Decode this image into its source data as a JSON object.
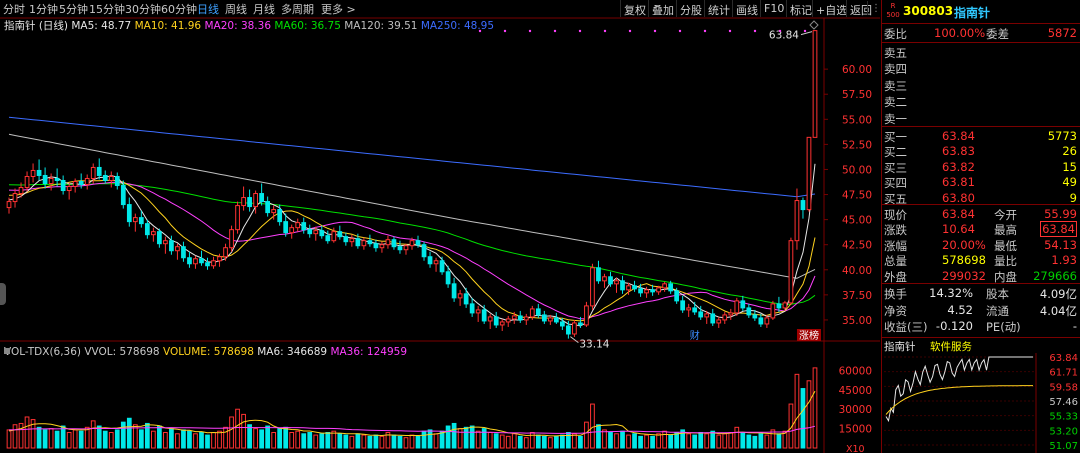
{
  "toolbar": {
    "periods": [
      "分时",
      "1分钟",
      "5分钟",
      "15分钟",
      "30分钟",
      "60分钟",
      "日线",
      "周线",
      "月线",
      "多周期",
      "更多 >"
    ],
    "active_period": "日线",
    "actions": [
      "复权",
      "叠加",
      "分股",
      "统计",
      "画线",
      "F10",
      "标记",
      "+自选",
      "返回"
    ]
  },
  "ma_legend": {
    "name": "指南针 (日线)",
    "items": [
      {
        "label": "MA5: 48.77",
        "color": "#e6e6e6"
      },
      {
        "label": "MA10: 41.96",
        "color": "#ffd21e"
      },
      {
        "label": "MA20: 38.36",
        "color": "#ff40ff"
      },
      {
        "label": "MA60: 36.75",
        "color": "#00e000"
      },
      {
        "label": "MA120: 39.51",
        "color": "#bfbfbf"
      },
      {
        "label": "MA250: 48.95",
        "color": "#3c6cff"
      }
    ]
  },
  "vol_legend": {
    "items": [
      {
        "label": "VOL-TDX(6,36)",
        "color": "#c8c8c8"
      },
      {
        "label": "VVOL: 578698",
        "color": "#c8c8c8"
      },
      {
        "label": "VOLUME: 578698",
        "color": "#ffd21e"
      },
      {
        "label": "MA6: 346689",
        "color": "#e6e6e6"
      },
      {
        "label": "MA36: 124959",
        "color": "#ff40ff"
      }
    ]
  },
  "chart_data": {
    "type": "candlestick",
    "price_axis": {
      "ticks": [
        "60.00",
        "57.50",
        "55.00",
        "52.50",
        "50.00",
        "47.50",
        "45.00",
        "42.50",
        "40.00",
        "37.50",
        "35.00"
      ],
      "range": [
        33.0,
        64.5
      ]
    },
    "volume_axis": {
      "ticks": [
        "60000",
        "45000",
        "30000",
        "15000"
      ],
      "unit": "X10"
    },
    "annotations": {
      "high": "63.84",
      "low": "33.14",
      "finance_badge": "财",
      "limit_badge": "涨榜"
    },
    "ohlc": [
      [
        46.2,
        47.2,
        45.6,
        46.8
      ],
      [
        46.8,
        48.1,
        46.2,
        47.6
      ],
      [
        47.6,
        48.7,
        47.2,
        48.2
      ],
      [
        48.2,
        49.8,
        47.8,
        49.3
      ],
      [
        49.3,
        50.6,
        48.7,
        49.9
      ],
      [
        49.9,
        51.0,
        48.9,
        49.4
      ],
      [
        49.4,
        50.2,
        48.1,
        48.6
      ],
      [
        48.6,
        49.6,
        47.9,
        49.1
      ],
      [
        49.1,
        50.1,
        48.3,
        48.9
      ],
      [
        48.9,
        49.4,
        47.5,
        47.9
      ],
      [
        47.9,
        48.6,
        47.0,
        48.3
      ],
      [
        48.3,
        49.1,
        47.7,
        48.8
      ],
      [
        48.8,
        49.6,
        48.1,
        48.5
      ],
      [
        48.5,
        49.5,
        48.0,
        49.1
      ],
      [
        49.1,
        50.6,
        48.6,
        50.2
      ],
      [
        50.2,
        51.1,
        49.0,
        49.4
      ],
      [
        49.4,
        49.9,
        48.6,
        48.9
      ],
      [
        48.9,
        49.8,
        48.2,
        49.3
      ],
      [
        49.3,
        49.7,
        48.0,
        48.4
      ],
      [
        48.4,
        48.9,
        46.1,
        46.5
      ],
      [
        46.5,
        47.2,
        44.3,
        44.8
      ],
      [
        44.8,
        45.6,
        43.8,
        45.2
      ],
      [
        45.2,
        45.9,
        44.2,
        44.6
      ],
      [
        44.6,
        45.0,
        43.1,
        43.5
      ],
      [
        43.5,
        44.2,
        42.8,
        43.8
      ],
      [
        43.8,
        44.1,
        42.2,
        42.6
      ],
      [
        42.6,
        43.3,
        41.6,
        42.9
      ],
      [
        42.9,
        43.4,
        41.5,
        41.9
      ],
      [
        41.9,
        42.6,
        41.0,
        42.3
      ],
      [
        42.3,
        42.8,
        40.8,
        41.2
      ],
      [
        41.2,
        41.8,
        40.2,
        40.6
      ],
      [
        40.6,
        41.4,
        40.1,
        41.1
      ],
      [
        41.1,
        41.9,
        40.4,
        40.7
      ],
      [
        40.7,
        41.2,
        40.0,
        40.4
      ],
      [
        40.4,
        41.3,
        40.1,
        40.9
      ],
      [
        40.9,
        41.6,
        40.3,
        41.3
      ],
      [
        41.3,
        42.6,
        40.9,
        42.2
      ],
      [
        42.2,
        44.4,
        41.8,
        44.0
      ],
      [
        44.0,
        46.8,
        43.6,
        46.4
      ],
      [
        46.4,
        48.3,
        45.9,
        47.2
      ],
      [
        47.2,
        48.0,
        45.8,
        46.3
      ],
      [
        46.3,
        47.9,
        45.6,
        47.6
      ],
      [
        47.6,
        48.6,
        46.4,
        46.8
      ],
      [
        46.8,
        47.3,
        45.3,
        45.7
      ],
      [
        45.7,
        46.4,
        45.0,
        46.0
      ],
      [
        46.0,
        46.5,
        44.4,
        44.8
      ],
      [
        44.8,
        45.6,
        43.3,
        43.7
      ],
      [
        43.7,
        44.5,
        43.1,
        44.2
      ],
      [
        44.2,
        45.1,
        43.8,
        44.7
      ],
      [
        44.7,
        45.2,
        43.6,
        44.0
      ],
      [
        44.0,
        44.5,
        43.2,
        43.6
      ],
      [
        43.6,
        44.3,
        42.9,
        43.9
      ],
      [
        43.9,
        44.4,
        43.1,
        43.4
      ],
      [
        43.4,
        43.9,
        42.6,
        42.9
      ],
      [
        42.9,
        44.2,
        42.7,
        43.8
      ],
      [
        43.8,
        44.4,
        43.0,
        43.3
      ],
      [
        43.3,
        43.7,
        42.4,
        42.8
      ],
      [
        42.8,
        43.5,
        42.3,
        43.1
      ],
      [
        43.1,
        43.6,
        42.1,
        42.4
      ],
      [
        42.4,
        43.2,
        42.0,
        42.9
      ],
      [
        42.9,
        43.5,
        42.3,
        42.6
      ],
      [
        42.6,
        43.0,
        41.8,
        42.2
      ],
      [
        42.2,
        42.8,
        41.7,
        42.5
      ],
      [
        42.5,
        43.4,
        42.1,
        43.0
      ],
      [
        43.0,
        43.3,
        42.0,
        42.3
      ],
      [
        42.3,
        42.9,
        41.6,
        42.0
      ],
      [
        42.0,
        42.6,
        41.5,
        42.4
      ],
      [
        42.4,
        43.2,
        42.0,
        42.9
      ],
      [
        42.9,
        43.4,
        42.2,
        42.5
      ],
      [
        42.5,
        42.8,
        40.9,
        41.3
      ],
      [
        41.3,
        41.8,
        40.2,
        40.6
      ],
      [
        40.6,
        41.2,
        39.8,
        40.9
      ],
      [
        40.9,
        41.3,
        39.5,
        39.8
      ],
      [
        39.8,
        40.4,
        38.2,
        38.6
      ],
      [
        38.6,
        39.2,
        36.8,
        37.2
      ],
      [
        37.2,
        38.0,
        36.4,
        37.6
      ],
      [
        37.6,
        38.2,
        36.2,
        36.6
      ],
      [
        36.6,
        37.2,
        35.3,
        35.7
      ],
      [
        35.7,
        36.4,
        34.8,
        36.0
      ],
      [
        36.0,
        36.5,
        34.6,
        34.9
      ],
      [
        34.9,
        35.6,
        34.1,
        35.3
      ],
      [
        35.3,
        35.8,
        34.2,
        34.5
      ],
      [
        34.5,
        35.1,
        33.9,
        34.8
      ],
      [
        34.8,
        35.4,
        34.3,
        35.1
      ],
      [
        35.1,
        35.8,
        34.6,
        35.4
      ],
      [
        35.4,
        35.9,
        34.7,
        35.0
      ],
      [
        35.0,
        35.6,
        34.5,
        35.3
      ],
      [
        35.3,
        36.4,
        35.0,
        36.1
      ],
      [
        36.1,
        36.6,
        35.2,
        35.5
      ],
      [
        35.5,
        35.9,
        34.6,
        34.9
      ],
      [
        34.9,
        35.5,
        34.5,
        35.2
      ],
      [
        35.2,
        35.7,
        34.6,
        34.8
      ],
      [
        34.8,
        35.2,
        34.0,
        34.4
      ],
      [
        34.4,
        34.9,
        33.14,
        33.6
      ],
      [
        33.6,
        35.0,
        33.3,
        34.7
      ],
      [
        34.7,
        35.3,
        34.2,
        34.5
      ],
      [
        34.5,
        36.8,
        34.3,
        36.4
      ],
      [
        36.4,
        40.6,
        36.0,
        40.2
      ],
      [
        40.2,
        40.9,
        38.6,
        38.9
      ],
      [
        38.9,
        39.6,
        38.2,
        39.3
      ],
      [
        39.3,
        39.8,
        38.3,
        38.6
      ],
      [
        38.6,
        39.2,
        37.7,
        38.9
      ],
      [
        38.9,
        39.4,
        37.6,
        38.0
      ],
      [
        38.0,
        38.7,
        37.5,
        38.4
      ],
      [
        38.4,
        38.9,
        37.8,
        38.1
      ],
      [
        38.1,
        38.6,
        37.3,
        37.7
      ],
      [
        37.7,
        38.3,
        37.2,
        38.0
      ],
      [
        38.0,
        38.5,
        37.4,
        37.8
      ],
      [
        37.8,
        38.4,
        37.5,
        38.2
      ],
      [
        38.2,
        38.8,
        37.8,
        38.6
      ],
      [
        38.6,
        38.9,
        37.6,
        37.9
      ],
      [
        37.9,
        38.2,
        36.6,
        36.9
      ],
      [
        36.9,
        37.4,
        35.7,
        36.0
      ],
      [
        36.0,
        36.6,
        35.3,
        36.2
      ],
      [
        36.2,
        36.8,
        35.5,
        35.8
      ],
      [
        35.8,
        36.4,
        35.0,
        35.3
      ],
      [
        35.3,
        35.9,
        34.6,
        35.6
      ],
      [
        35.6,
        36.1,
        34.4,
        34.7
      ],
      [
        34.7,
        35.3,
        34.2,
        35.0
      ],
      [
        35.0,
        35.8,
        34.6,
        35.5
      ],
      [
        35.5,
        36.1,
        35.0,
        35.7
      ],
      [
        35.7,
        37.2,
        35.4,
        36.9
      ],
      [
        36.9,
        37.4,
        35.9,
        36.2
      ],
      [
        36.2,
        36.6,
        35.2,
        35.5
      ],
      [
        35.5,
        36.0,
        34.9,
        35.2
      ],
      [
        35.2,
        35.6,
        34.3,
        34.6
      ],
      [
        34.6,
        35.5,
        34.2,
        35.2
      ],
      [
        35.2,
        36.9,
        35.0,
        36.6
      ],
      [
        36.6,
        37.3,
        35.8,
        36.2
      ],
      [
        36.2,
        36.9,
        35.9,
        36.7
      ],
      [
        36.7,
        43.2,
        36.5,
        42.9
      ],
      [
        42.9,
        48.1,
        42.0,
        46.9
      ],
      [
        46.9,
        47.2,
        45.1,
        46.0
      ],
      [
        46.0,
        53.2,
        45.8,
        53.2
      ],
      [
        53.2,
        63.84,
        53.2,
        63.84
      ]
    ],
    "volume": [
      14000,
      18000,
      19000,
      24000,
      22000,
      16000,
      14000,
      15000,
      13000,
      17000,
      12000,
      14000,
      13000,
      16000,
      21000,
      17000,
      13000,
      12000,
      14000,
      20000,
      23000,
      18000,
      14000,
      19000,
      13000,
      17000,
      12000,
      15000,
      11000,
      14000,
      13000,
      11000,
      12000,
      10000,
      12000,
      13000,
      16000,
      24000,
      30000,
      26000,
      18000,
      15000,
      14000,
      17000,
      12000,
      15000,
      16000,
      12000,
      13000,
      11000,
      12000,
      10000,
      11000,
      12000,
      13000,
      11000,
      10000,
      9000,
      11000,
      10000,
      9000,
      10000,
      9000,
      12000,
      10000,
      9000,
      8000,
      10000,
      9000,
      13000,
      14000,
      11000,
      13000,
      17000,
      19000,
      15000,
      16000,
      17000,
      13000,
      15000,
      12000,
      11000,
      10000,
      9000,
      11000,
      9000,
      8000,
      12000,
      10000,
      9000,
      8000,
      9000,
      10000,
      12000,
      11000,
      9000,
      20000,
      34000,
      18000,
      14000,
      12000,
      11000,
      13000,
      10000,
      11000,
      9000,
      10000,
      9000,
      11000,
      13000,
      10000,
      12000,
      14000,
      11000,
      10000,
      12000,
      11000,
      13000,
      10000,
      11000,
      12000,
      16000,
      12000,
      10000,
      9000,
      11000,
      10000,
      14000,
      11000,
      13000,
      34000,
      57000,
      46000,
      52000,
      62000
    ]
  },
  "quote": {
    "market_badge": "R\n500",
    "code": "300803",
    "name": "指南针",
    "weibi_label": "委比",
    "weibi_value": "100.00%",
    "weicha_label": "委差",
    "weicha_value": "5872",
    "sell": [
      {
        "label": "卖五",
        "price": "",
        "vol": ""
      },
      {
        "label": "卖四",
        "price": "",
        "vol": ""
      },
      {
        "label": "卖三",
        "price": "",
        "vol": ""
      },
      {
        "label": "卖二",
        "price": "",
        "vol": ""
      },
      {
        "label": "卖一",
        "price": "",
        "vol": ""
      }
    ],
    "buy": [
      {
        "label": "买一",
        "price": "63.84",
        "vol": "5773"
      },
      {
        "label": "买二",
        "price": "63.83",
        "vol": "26"
      },
      {
        "label": "买三",
        "price": "63.82",
        "vol": "15"
      },
      {
        "label": "买四",
        "price": "63.81",
        "vol": "49"
      },
      {
        "label": "买五",
        "price": "63.80",
        "vol": "9"
      }
    ],
    "stats": [
      {
        "l1": "现价",
        "v1": "63.84",
        "c1": "red",
        "l2": "今开",
        "v2": "55.99",
        "c2": "red"
      },
      {
        "l1": "涨跌",
        "v1": "10.64",
        "c1": "red",
        "l2": "最高",
        "v2": "63.84",
        "c2": "red"
      },
      {
        "l1": "涨幅",
        "v1": "20.00%",
        "c1": "red",
        "l2": "最低",
        "v2": "54.13",
        "c2": "red"
      },
      {
        "l1": "总量",
        "v1": "578698",
        "c1": "yel",
        "l2": "量比",
        "v2": "1.93",
        "c2": "red"
      },
      {
        "l1": "外盘",
        "v1": "299032",
        "c1": "red",
        "l2": "内盘",
        "v2": "279666",
        "c2": "green"
      }
    ],
    "fund": [
      {
        "l1": "换手",
        "v1": "14.32%",
        "l2": "股本",
        "v2": "4.09亿"
      },
      {
        "l1": "净资",
        "v1": "4.52",
        "l2": "流通",
        "v2": "4.04亿"
      },
      {
        "l1": "收益(三)",
        "v1": "-0.120",
        "l2": "PE(动)",
        "v2": "-"
      }
    ],
    "mini": {
      "name": "指南针",
      "sector": "软件服务",
      "ticks": [
        "63.84",
        "61.71",
        "59.58",
        "57.46",
        "55.33",
        "53.20",
        "51.07"
      ]
    }
  },
  "colors": {
    "up": "#ff3232",
    "down": "#00e8e8",
    "grid": "#7a0000",
    "axis_text": "#ff3232"
  }
}
